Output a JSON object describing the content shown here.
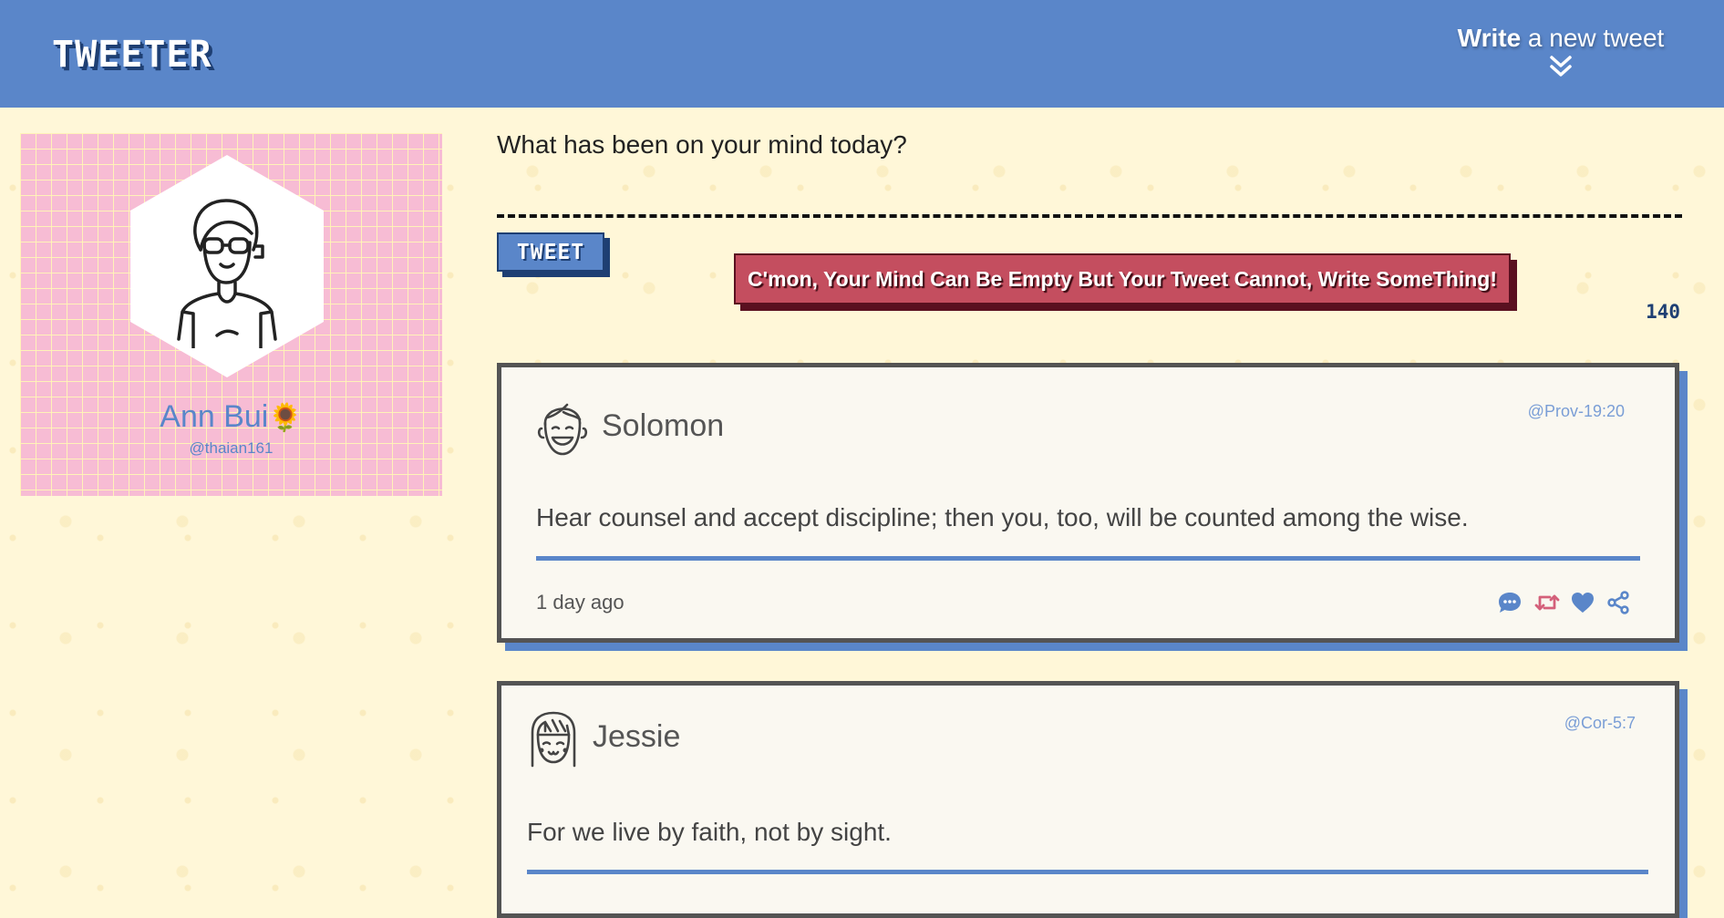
{
  "nav": {
    "brand": "TWEETER",
    "compose_bold": "Write",
    "compose_rest": " a new tweet"
  },
  "profile": {
    "name": "Ann Bui",
    "emoji": "🌻",
    "handle": "@thaian161"
  },
  "composer": {
    "placeholder": "What has been on your mind today?",
    "button_label": "TWEET",
    "error": "C'mon, Your Mind Can Be Empty But Your Tweet Cannot, Write SomeThing!",
    "counter": "140"
  },
  "tweets": [
    {
      "author": "Solomon",
      "handle": "@Prov-19:20",
      "content": "Hear counsel and accept discipline; then you, too, will be counted among the wise.",
      "time": "1 day ago",
      "avatar_icon": "smiling-boy-avatar-icon"
    },
    {
      "author": "Jessie",
      "handle": "@Cor-5:7",
      "content": "For we live by faith, not by sight.",
      "avatar_icon": "girl-with-bangs-avatar-icon"
    }
  ],
  "colors": {
    "accent": "#5a86c9",
    "accent_dark": "#1e3f73",
    "background": "#fff7d8",
    "error": "#c44e5f",
    "profile_bg": "#f7bcd4",
    "retweet": "#d4607a"
  }
}
